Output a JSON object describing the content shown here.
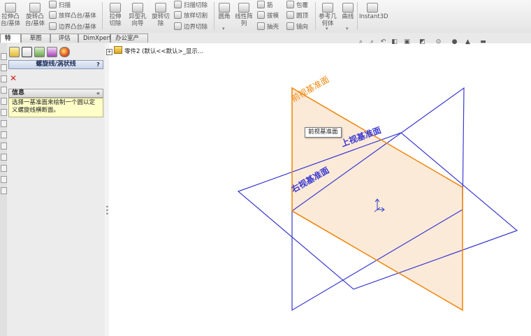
{
  "ribbon": {
    "extrude_boss": "拉伸凸台/基体",
    "revolve_boss": "旋转凸台/基体",
    "sweep": "扫描",
    "loft": "放样凸台/基体",
    "boundary_boss": "边界凸台/基体",
    "extrude_cut": "拉伸切除",
    "hole_wizard": "异型孔向导",
    "revolve_cut": "旋转切除",
    "swept_cut": "扫描切除",
    "lofted_cut": "放样切割",
    "boundary_cut": "边界切除",
    "fillet": "圆角",
    "linear_pattern": "线性阵列",
    "rib": "筋",
    "draft": "拔模",
    "shell": "抽壳",
    "wrap": "包覆",
    "dome": "圆顶",
    "mirror": "镜向",
    "reference_geometry": "参考几何体",
    "curves": "曲线",
    "instant3d": "Instant3D"
  },
  "tabs": [
    {
      "label": "特征",
      "active": true
    },
    {
      "label": "草图",
      "active": false
    },
    {
      "label": "评估",
      "active": false
    },
    {
      "label": "DimXpert",
      "active": false
    },
    {
      "label": "办公室产品",
      "active": false
    }
  ],
  "property_manager": {
    "title": "螺旋线/涡状线",
    "help": "?",
    "info_header": "信息",
    "info_text_line1": "选择一基准面来绘制一个圆以定",
    "info_text_line2": "义螺旋线横断面。"
  },
  "tree": {
    "expand": "+",
    "part_label": "零件2 (默认<<默认>_显示..."
  },
  "viewport": {
    "front_plane": "前视基准面",
    "top_plane": "上视基准面",
    "right_plane": "右视基准面",
    "tooltip": "前视基准面",
    "front_plane_color": "#f08a14",
    "plane_color": "#3a3ad0",
    "front_fill_color": "#fbe6d2"
  },
  "icons": {
    "view_toolbar": [
      "zoom-fit-icon",
      "zoom-area-icon",
      "previous-view-icon",
      "section-view-icon",
      "view-orientation-icon",
      "display-style-icon",
      "hide-show-icon",
      "edit-appearance-icon",
      "apply-scene-icon",
      "view-settings-icon"
    ],
    "pm_tabs": [
      "feature-manager-icon",
      "property-manager-icon",
      "configuration-manager-icon",
      "dimxpert-manager-icon",
      "display-manager-icon"
    ]
  }
}
